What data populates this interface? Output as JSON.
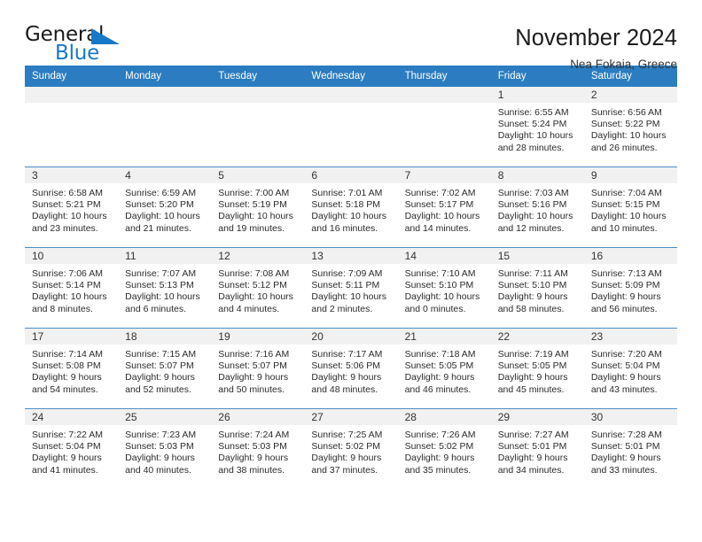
{
  "brand": {
    "word_general": "General",
    "word_blue": "Blue",
    "flag_icon": "triangle-flag-icon",
    "accent_color": "#1878c8"
  },
  "header": {
    "title": "November 2024",
    "subtitle": "Nea Fokaia, Greece"
  },
  "theme": {
    "header_blue": "#2b7cc0",
    "row_line": "#4a8fc8",
    "daynum_band": "#f1f1f1"
  },
  "calendar": {
    "weekday_headers": [
      "Sunday",
      "Monday",
      "Tuesday",
      "Wednesday",
      "Thursday",
      "Friday",
      "Saturday"
    ],
    "weeks": [
      [
        {
          "day": "",
          "empty": true
        },
        {
          "day": "",
          "empty": true
        },
        {
          "day": "",
          "empty": true
        },
        {
          "day": "",
          "empty": true
        },
        {
          "day": "",
          "empty": true
        },
        {
          "day": "1",
          "sunrise": "Sunrise: 6:55 AM",
          "sunset": "Sunset: 5:24 PM",
          "daylight": "Daylight: 10 hours and 28 minutes."
        },
        {
          "day": "2",
          "sunrise": "Sunrise: 6:56 AM",
          "sunset": "Sunset: 5:22 PM",
          "daylight": "Daylight: 10 hours and 26 minutes."
        }
      ],
      [
        {
          "day": "3",
          "sunrise": "Sunrise: 6:58 AM",
          "sunset": "Sunset: 5:21 PM",
          "daylight": "Daylight: 10 hours and 23 minutes."
        },
        {
          "day": "4",
          "sunrise": "Sunrise: 6:59 AM",
          "sunset": "Sunset: 5:20 PM",
          "daylight": "Daylight: 10 hours and 21 minutes."
        },
        {
          "day": "5",
          "sunrise": "Sunrise: 7:00 AM",
          "sunset": "Sunset: 5:19 PM",
          "daylight": "Daylight: 10 hours and 19 minutes."
        },
        {
          "day": "6",
          "sunrise": "Sunrise: 7:01 AM",
          "sunset": "Sunset: 5:18 PM",
          "daylight": "Daylight: 10 hours and 16 minutes."
        },
        {
          "day": "7",
          "sunrise": "Sunrise: 7:02 AM",
          "sunset": "Sunset: 5:17 PM",
          "daylight": "Daylight: 10 hours and 14 minutes."
        },
        {
          "day": "8",
          "sunrise": "Sunrise: 7:03 AM",
          "sunset": "Sunset: 5:16 PM",
          "daylight": "Daylight: 10 hours and 12 minutes."
        },
        {
          "day": "9",
          "sunrise": "Sunrise: 7:04 AM",
          "sunset": "Sunset: 5:15 PM",
          "daylight": "Daylight: 10 hours and 10 minutes."
        }
      ],
      [
        {
          "day": "10",
          "sunrise": "Sunrise: 7:06 AM",
          "sunset": "Sunset: 5:14 PM",
          "daylight": "Daylight: 10 hours and 8 minutes."
        },
        {
          "day": "11",
          "sunrise": "Sunrise: 7:07 AM",
          "sunset": "Sunset: 5:13 PM",
          "daylight": "Daylight: 10 hours and 6 minutes."
        },
        {
          "day": "12",
          "sunrise": "Sunrise: 7:08 AM",
          "sunset": "Sunset: 5:12 PM",
          "daylight": "Daylight: 10 hours and 4 minutes."
        },
        {
          "day": "13",
          "sunrise": "Sunrise: 7:09 AM",
          "sunset": "Sunset: 5:11 PM",
          "daylight": "Daylight: 10 hours and 2 minutes."
        },
        {
          "day": "14",
          "sunrise": "Sunrise: 7:10 AM",
          "sunset": "Sunset: 5:10 PM",
          "daylight": "Daylight: 10 hours and 0 minutes."
        },
        {
          "day": "15",
          "sunrise": "Sunrise: 7:11 AM",
          "sunset": "Sunset: 5:10 PM",
          "daylight": "Daylight: 9 hours and 58 minutes."
        },
        {
          "day": "16",
          "sunrise": "Sunrise: 7:13 AM",
          "sunset": "Sunset: 5:09 PM",
          "daylight": "Daylight: 9 hours and 56 minutes."
        }
      ],
      [
        {
          "day": "17",
          "sunrise": "Sunrise: 7:14 AM",
          "sunset": "Sunset: 5:08 PM",
          "daylight": "Daylight: 9 hours and 54 minutes."
        },
        {
          "day": "18",
          "sunrise": "Sunrise: 7:15 AM",
          "sunset": "Sunset: 5:07 PM",
          "daylight": "Daylight: 9 hours and 52 minutes."
        },
        {
          "day": "19",
          "sunrise": "Sunrise: 7:16 AM",
          "sunset": "Sunset: 5:07 PM",
          "daylight": "Daylight: 9 hours and 50 minutes."
        },
        {
          "day": "20",
          "sunrise": "Sunrise: 7:17 AM",
          "sunset": "Sunset: 5:06 PM",
          "daylight": "Daylight: 9 hours and 48 minutes."
        },
        {
          "day": "21",
          "sunrise": "Sunrise: 7:18 AM",
          "sunset": "Sunset: 5:05 PM",
          "daylight": "Daylight: 9 hours and 46 minutes."
        },
        {
          "day": "22",
          "sunrise": "Sunrise: 7:19 AM",
          "sunset": "Sunset: 5:05 PM",
          "daylight": "Daylight: 9 hours and 45 minutes."
        },
        {
          "day": "23",
          "sunrise": "Sunrise: 7:20 AM",
          "sunset": "Sunset: 5:04 PM",
          "daylight": "Daylight: 9 hours and 43 minutes."
        }
      ],
      [
        {
          "day": "24",
          "sunrise": "Sunrise: 7:22 AM",
          "sunset": "Sunset: 5:04 PM",
          "daylight": "Daylight: 9 hours and 41 minutes."
        },
        {
          "day": "25",
          "sunrise": "Sunrise: 7:23 AM",
          "sunset": "Sunset: 5:03 PM",
          "daylight": "Daylight: 9 hours and 40 minutes."
        },
        {
          "day": "26",
          "sunrise": "Sunrise: 7:24 AM",
          "sunset": "Sunset: 5:03 PM",
          "daylight": "Daylight: 9 hours and 38 minutes."
        },
        {
          "day": "27",
          "sunrise": "Sunrise: 7:25 AM",
          "sunset": "Sunset: 5:02 PM",
          "daylight": "Daylight: 9 hours and 37 minutes."
        },
        {
          "day": "28",
          "sunrise": "Sunrise: 7:26 AM",
          "sunset": "Sunset: 5:02 PM",
          "daylight": "Daylight: 9 hours and 35 minutes."
        },
        {
          "day": "29",
          "sunrise": "Sunrise: 7:27 AM",
          "sunset": "Sunset: 5:01 PM",
          "daylight": "Daylight: 9 hours and 34 minutes."
        },
        {
          "day": "30",
          "sunrise": "Sunrise: 7:28 AM",
          "sunset": "Sunset: 5:01 PM",
          "daylight": "Daylight: 9 hours and 33 minutes."
        }
      ]
    ]
  }
}
